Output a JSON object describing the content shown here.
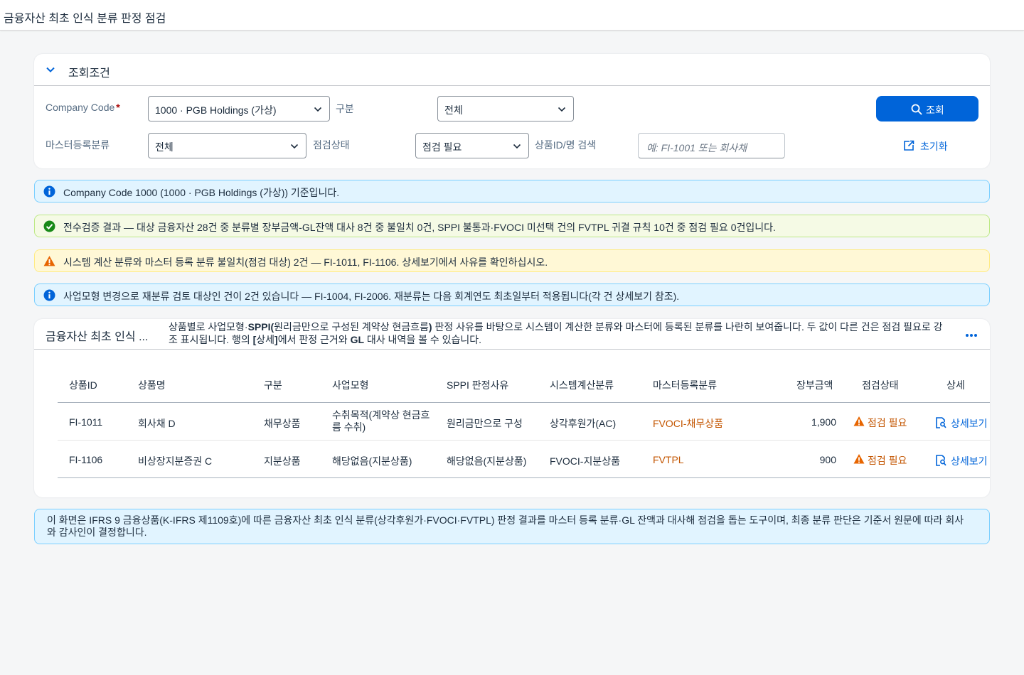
{
  "app": {
    "title": "금융자산 최초 인식 분류 판정 점검"
  },
  "filter": {
    "title": "조회조건",
    "company_code_label": "Company Code",
    "required_mark": "*",
    "company_code_value": "1000 · PGB Holdings (가상)",
    "category_label": "구분",
    "category_value": "전체",
    "master_class_label": "마스터등록분류",
    "master_class_value": "전체",
    "status_label": "점검상태",
    "status_value": "점검 필요",
    "search_label": "상품ID/명 검색",
    "search_placeholder": "예: FI-1001 또는 회사채",
    "search_button": "조회",
    "reset_button": "초기화"
  },
  "messages": [
    {
      "type": "info",
      "text": "Company Code 1000 (1000 · PGB Holdings (가상)) 기준입니다."
    },
    {
      "type": "success",
      "text": "전수검증 결과 — 대상 금융자산 28건 중 분류별 장부금액-GL잔액 대사 8건 중 불일치 0건, SPPI 불통과·FVOCI 미선택 건의 FVTPL 귀결 규칙 10건 중 점검 필요 0건입니다."
    },
    {
      "type": "warning",
      "text": "시스템 계산 분류와 마스터 등록 분류 불일치(점검 대상) 2건 — FI-1011, FI-1106. 상세보기에서 사유를 확인하십시오."
    },
    {
      "type": "info",
      "text": "사업모형 변경으로 재분류 검토 대상인 건이 2건 있습니다 — FI-1004, FI-2006. 재분류는 다음 회계연도 최초일부터 적용됩니다(각 건 상세보기 참조)."
    }
  ],
  "table_card": {
    "title": "금융자산 최초 인식 ...",
    "description_parts": [
      "상품별로 사업모형·",
      "SPPI(",
      "원리금만으로 구성된 계약상 현금흐름",
      ")",
      " 판정 사유를 바탕으로 시스템이 계산한 분류와 마스터에 등록된 분류를 나란히 보여줍니다. 두 값이 다른 건은 점검 필요로 강조 표시됩니다. 행의 ",
      "[",
      "상세",
      "]",
      "에서 판정 근거와 ",
      "GL",
      " 대사 내역을 볼 수 있습니다."
    ],
    "columns": [
      "상품ID",
      "상품명",
      "구분",
      "사업모형",
      "SPPI 판정사유",
      "시스템계산분류",
      "마스터등록분류",
      "장부금액",
      "점검상태",
      "상세"
    ],
    "rows": [
      {
        "id": "FI-1011",
        "name": "회사채 D",
        "category": "채무상품",
        "business_model": "수취목적(계약상 현금흐름 수취)",
        "sppi_reason": "원리금만으로 구성",
        "system_class": "상각후원가(AC)",
        "master_class": "FVOCI-채무상품",
        "amount": "1,900",
        "status": "점검 필요",
        "detail": "상세보기"
      },
      {
        "id": "FI-1106",
        "name": "비상장지분증권 C",
        "category": "지분상품",
        "business_model": "해당없음(지분상품)",
        "sppi_reason": "해당없음(지분상품)",
        "system_class": "FVOCI-지분상품",
        "master_class": "FVTPL",
        "amount": "900",
        "status": "점검 필요",
        "detail": "상세보기"
      }
    ]
  },
  "footer_note": "이 화면은 IFRS 9 금융상품(K-IFRS 제1109호)에 따른 금융자산 최초 인식 분류(상각후원가·FVOCI·FVTPL) 판정 결과를 마스터 등록 분류·GL 잔액과 대사해 점검을 돕는 도구이며, 최종 분류 판단은 기준서 원문에 따라 회사와 감사인이 결정합니다.",
  "icons": {
    "collapse": "chevron-down-icon",
    "dropdown": "chevron-down-icon",
    "search": "search-icon",
    "reset": "reset-icon",
    "info": "info-icon",
    "success": "check-circle-icon",
    "warning": "warning-triangle-icon",
    "more": "overflow-more-icon",
    "detail": "detail-view-icon"
  },
  "colors": {
    "accent": "#0064d9",
    "mismatch_text": "#c35500",
    "info_bg": "#e1f4ff",
    "success_bg": "#f5fae5",
    "warning_bg": "#fff8d6"
  }
}
